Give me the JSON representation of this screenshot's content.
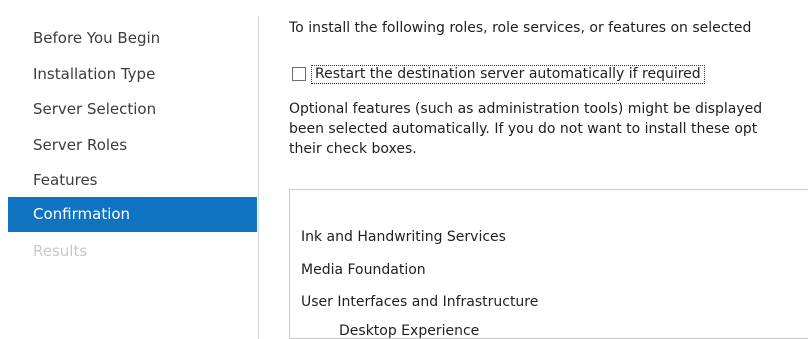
{
  "nav": {
    "items": [
      {
        "label": "Before You Begin",
        "state": "normal"
      },
      {
        "label": "Installation Type",
        "state": "normal"
      },
      {
        "label": "Server Selection",
        "state": "normal"
      },
      {
        "label": "Server Roles",
        "state": "normal"
      },
      {
        "label": "Features",
        "state": "normal"
      },
      {
        "label": "Confirmation",
        "state": "active"
      },
      {
        "label": "Results",
        "state": "disabled"
      }
    ]
  },
  "main": {
    "intro": "To install the following roles, role services, or features on selected",
    "restart_checkbox": {
      "label": "Restart the destination server automatically if required",
      "checked": false
    },
    "optional_text": [
      "Optional features (such as administration tools) might be displayed",
      "been selected automatically. If you do not want to install these opt",
      "their check boxes."
    ],
    "features": [
      {
        "label": "Ink and Handwriting Services",
        "level": 0
      },
      {
        "label": "Media Foundation",
        "level": 0
      },
      {
        "label": "User Interfaces and Infrastructure",
        "level": 0
      },
      {
        "label": "Desktop Experience",
        "level": 1
      }
    ]
  },
  "colors": {
    "active_nav_background": "#0f73c2",
    "disabled_nav_text": "#c8c8c8"
  }
}
